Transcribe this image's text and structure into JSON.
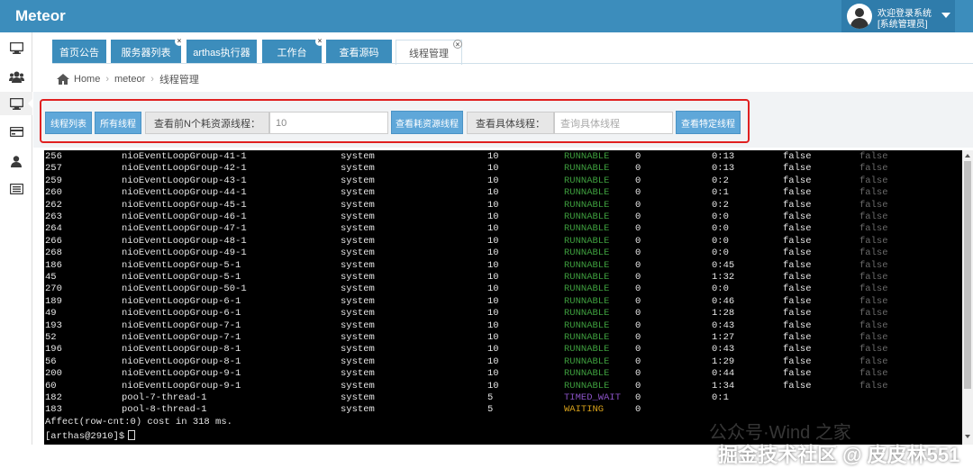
{
  "app": {
    "title": "Meteor"
  },
  "user": {
    "line1": "欢迎登录系统",
    "line2": "[系统管理员]"
  },
  "sidebar": {
    "items": [
      {
        "icon": "desktop-icon",
        "active": false
      },
      {
        "icon": "users-icon",
        "active": false
      },
      {
        "icon": "desktop-icon",
        "active": true
      },
      {
        "icon": "credit-card-icon",
        "active": false
      },
      {
        "icon": "user-icon",
        "active": false
      },
      {
        "icon": "list-icon",
        "active": false
      }
    ]
  },
  "tabs": [
    {
      "label": "首页公告",
      "closable": false,
      "active": false
    },
    {
      "label": "服务器列表",
      "closable": true,
      "active": false
    },
    {
      "label": "arthas执行器",
      "closable": false,
      "active": false
    },
    {
      "label": "工作台",
      "closable": true,
      "active": false
    },
    {
      "label": "查看源码",
      "closable": false,
      "active": false
    },
    {
      "label": "线程管理",
      "closable": true,
      "active": true
    }
  ],
  "breadcrumb": {
    "home": "Home",
    "level1": "meteor",
    "level2": "线程管理"
  },
  "toolbar": {
    "thread_list_button": "线程列表",
    "all_threads_button": "所有线程",
    "top_n_label": "查看前N个耗资源线程：",
    "top_n_value": "10",
    "top_n_button": "查看耗资源线程",
    "specific_label": "查看具体线程：",
    "specific_placeholder": "查询具体线程",
    "specific_button": "查看特定线程"
  },
  "terminal": {
    "rows": [
      {
        "id": "256",
        "name": "nioEventLoopGroup-41-1",
        "group": "system",
        "priority": "10",
        "state": "RUNNABLE",
        "cpu": "0",
        "time": "0:13",
        "interrupted": "false",
        "daemon": "false"
      },
      {
        "id": "257",
        "name": "nioEventLoopGroup-42-1",
        "group": "system",
        "priority": "10",
        "state": "RUNNABLE",
        "cpu": "0",
        "time": "0:13",
        "interrupted": "false",
        "daemon": "false"
      },
      {
        "id": "259",
        "name": "nioEventLoopGroup-43-1",
        "group": "system",
        "priority": "10",
        "state": "RUNNABLE",
        "cpu": "0",
        "time": "0:2",
        "interrupted": "false",
        "daemon": "false"
      },
      {
        "id": "260",
        "name": "nioEventLoopGroup-44-1",
        "group": "system",
        "priority": "10",
        "state": "RUNNABLE",
        "cpu": "0",
        "time": "0:1",
        "interrupted": "false",
        "daemon": "false"
      },
      {
        "id": "262",
        "name": "nioEventLoopGroup-45-1",
        "group": "system",
        "priority": "10",
        "state": "RUNNABLE",
        "cpu": "0",
        "time": "0:2",
        "interrupted": "false",
        "daemon": "false"
      },
      {
        "id": "263",
        "name": "nioEventLoopGroup-46-1",
        "group": "system",
        "priority": "10",
        "state": "RUNNABLE",
        "cpu": "0",
        "time": "0:0",
        "interrupted": "false",
        "daemon": "false"
      },
      {
        "id": "264",
        "name": "nioEventLoopGroup-47-1",
        "group": "system",
        "priority": "10",
        "state": "RUNNABLE",
        "cpu": "0",
        "time": "0:0",
        "interrupted": "false",
        "daemon": "false"
      },
      {
        "id": "266",
        "name": "nioEventLoopGroup-48-1",
        "group": "system",
        "priority": "10",
        "state": "RUNNABLE",
        "cpu": "0",
        "time": "0:0",
        "interrupted": "false",
        "daemon": "false"
      },
      {
        "id": "268",
        "name": "nioEventLoopGroup-49-1",
        "group": "system",
        "priority": "10",
        "state": "RUNNABLE",
        "cpu": "0",
        "time": "0:0",
        "interrupted": "false",
        "daemon": "false"
      },
      {
        "id": "186",
        "name": "nioEventLoopGroup-5-1",
        "group": "system",
        "priority": "10",
        "state": "RUNNABLE",
        "cpu": "0",
        "time": "0:45",
        "interrupted": "false",
        "daemon": "false"
      },
      {
        "id": "45",
        "name": "nioEventLoopGroup-5-1",
        "group": "system",
        "priority": "10",
        "state": "RUNNABLE",
        "cpu": "0",
        "time": "1:32",
        "interrupted": "false",
        "daemon": "false"
      },
      {
        "id": "270",
        "name": "nioEventLoopGroup-50-1",
        "group": "system",
        "priority": "10",
        "state": "RUNNABLE",
        "cpu": "0",
        "time": "0:0",
        "interrupted": "false",
        "daemon": "false"
      },
      {
        "id": "189",
        "name": "nioEventLoopGroup-6-1",
        "group": "system",
        "priority": "10",
        "state": "RUNNABLE",
        "cpu": "0",
        "time": "0:46",
        "interrupted": "false",
        "daemon": "false"
      },
      {
        "id": "49",
        "name": "nioEventLoopGroup-6-1",
        "group": "system",
        "priority": "10",
        "state": "RUNNABLE",
        "cpu": "0",
        "time": "1:28",
        "interrupted": "false",
        "daemon": "false"
      },
      {
        "id": "193",
        "name": "nioEventLoopGroup-7-1",
        "group": "system",
        "priority": "10",
        "state": "RUNNABLE",
        "cpu": "0",
        "time": "0:43",
        "interrupted": "false",
        "daemon": "false"
      },
      {
        "id": "52",
        "name": "nioEventLoopGroup-7-1",
        "group": "system",
        "priority": "10",
        "state": "RUNNABLE",
        "cpu": "0",
        "time": "1:27",
        "interrupted": "false",
        "daemon": "false"
      },
      {
        "id": "196",
        "name": "nioEventLoopGroup-8-1",
        "group": "system",
        "priority": "10",
        "state": "RUNNABLE",
        "cpu": "0",
        "time": "0:43",
        "interrupted": "false",
        "daemon": "false"
      },
      {
        "id": "56",
        "name": "nioEventLoopGroup-8-1",
        "group": "system",
        "priority": "10",
        "state": "RUNNABLE",
        "cpu": "0",
        "time": "1:29",
        "interrupted": "false",
        "daemon": "false"
      },
      {
        "id": "200",
        "name": "nioEventLoopGroup-9-1",
        "group": "system",
        "priority": "10",
        "state": "RUNNABLE",
        "cpu": "0",
        "time": "0:44",
        "interrupted": "false",
        "daemon": "false"
      },
      {
        "id": "60",
        "name": "nioEventLoopGroup-9-1",
        "group": "system",
        "priority": "10",
        "state": "RUNNABLE",
        "cpu": "0",
        "time": "1:34",
        "interrupted": "false",
        "daemon": "false"
      },
      {
        "id": "182",
        "name": "pool-7-thread-1",
        "group": "system",
        "priority": "5",
        "state": "TIMED_WAIT",
        "cpu": "0",
        "time": "0:1",
        "interrupted": "",
        "daemon": ""
      },
      {
        "id": "183",
        "name": "pool-8-thread-1",
        "group": "system",
        "priority": "5",
        "state": "WAITING",
        "cpu": "0",
        "time": "",
        "interrupted": "",
        "daemon": ""
      }
    ],
    "summary": "Affect(row-cnt:0) cost in 318 ms.",
    "prompt": "[arthas@2910]$"
  },
  "watermark": {
    "line1": "公众号·Wind 之家",
    "line2": "掘金技术社区 @ 皮皮林551"
  },
  "colors": {
    "header": "#3c8dbc",
    "runnable": "#3d9c3d",
    "timed_wait": "#8a52c6",
    "waiting": "#d7a11b",
    "highlight_box": "#e02020"
  }
}
